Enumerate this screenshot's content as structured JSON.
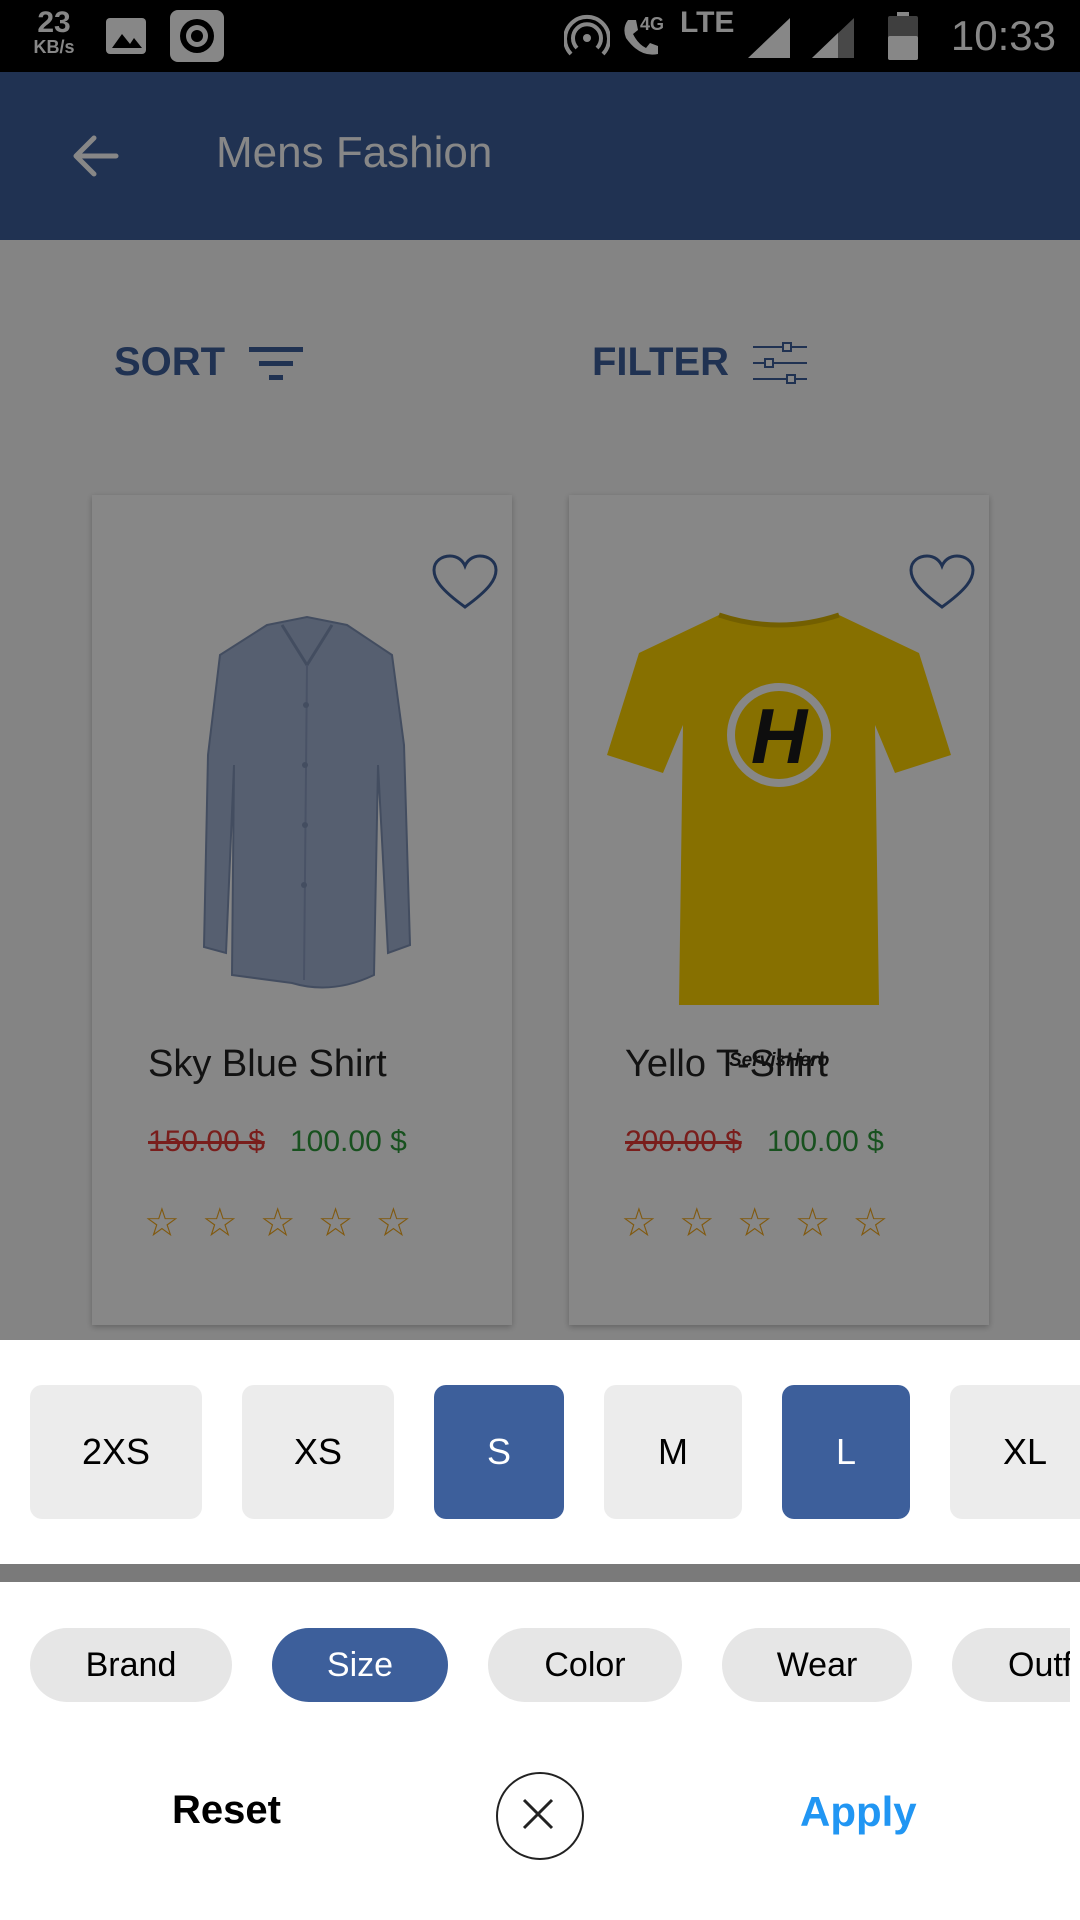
{
  "status_bar": {
    "speed_value": "23",
    "speed_unit": "KB/s",
    "network_4g": "4G",
    "network_lte": "LTE",
    "time": "10:33",
    "icons": [
      "image-icon",
      "record-icon",
      "hotspot-icon",
      "wifi-calling-icon",
      "signal-icon",
      "signal-icon",
      "battery-icon"
    ]
  },
  "app_bar": {
    "title": "Mens Fashion",
    "back_icon": "arrow-back-icon",
    "color": "#3d5f9b"
  },
  "toolbar": {
    "sort_label": "SORT",
    "filter_label": "FILTER"
  },
  "products": [
    {
      "name": "Sky Blue Shirt",
      "old_price": "150.00 $",
      "new_price": "100.00 $",
      "rating": 0,
      "rating_max": 5,
      "image_icon": "shirt-image"
    },
    {
      "name": "Yello T-Shirt",
      "old_price": "200.00 $",
      "new_price": "100.00 $",
      "rating": 0,
      "rating_max": 5,
      "image_icon": "tshirt-image",
      "logo_text": "ServisHero"
    }
  ],
  "size_options": [
    {
      "label": "2XS",
      "selected": false
    },
    {
      "label": "XS",
      "selected": false
    },
    {
      "label": "S",
      "selected": true
    },
    {
      "label": "M",
      "selected": false
    },
    {
      "label": "L",
      "selected": true
    },
    {
      "label": "XL",
      "selected": false
    }
  ],
  "filter_categories": [
    {
      "label": "Brand",
      "selected": false
    },
    {
      "label": "Size",
      "selected": true
    },
    {
      "label": "Color",
      "selected": false
    },
    {
      "label": "Wear",
      "selected": false
    },
    {
      "label": "Outf",
      "selected": false
    }
  ],
  "actions": {
    "reset_label": "Reset",
    "apply_label": "Apply",
    "close_icon": "close-icon"
  },
  "colors": {
    "primary": "#3d5f9b",
    "old_price": "#e53935",
    "new_price": "#2e9a3c",
    "star": "#f3a81b",
    "apply": "#2196f3"
  }
}
